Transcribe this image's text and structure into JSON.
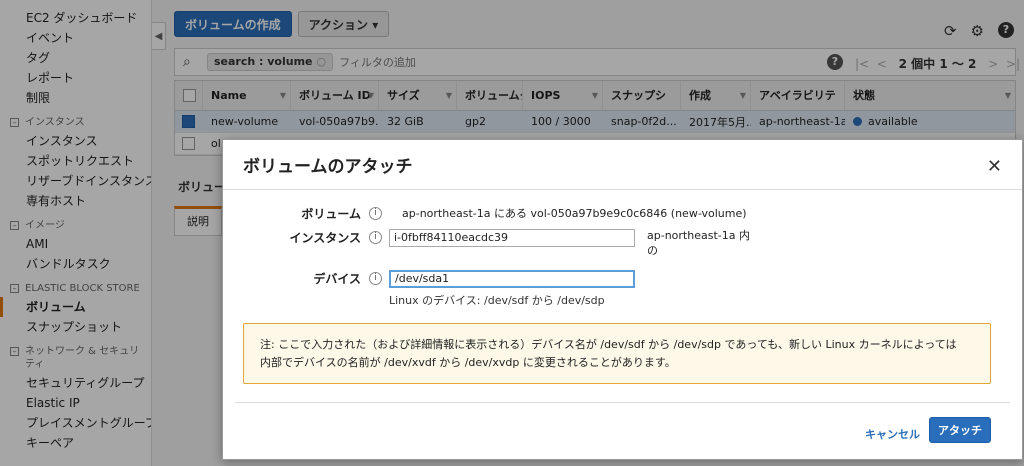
{
  "sidebar": {
    "items": [
      {
        "label": "EC2 ダッシュボード",
        "type": "item"
      },
      {
        "label": "イベント",
        "type": "item"
      },
      {
        "label": "タグ",
        "type": "item"
      },
      {
        "label": "レポート",
        "type": "item"
      },
      {
        "label": "制限",
        "type": "item"
      },
      {
        "label": "インスタンス",
        "type": "section"
      },
      {
        "label": "インスタンス",
        "type": "item"
      },
      {
        "label": "スポットリクエスト",
        "type": "item"
      },
      {
        "label": "リザーブドインスタンス",
        "type": "item"
      },
      {
        "label": "専有ホスト",
        "type": "item"
      },
      {
        "label": "イメージ",
        "type": "section"
      },
      {
        "label": "AMI",
        "type": "item"
      },
      {
        "label": "バンドルタスク",
        "type": "item"
      },
      {
        "label": "ELASTIC BLOCK STORE",
        "type": "section"
      },
      {
        "label": "ボリューム",
        "type": "item",
        "active": true
      },
      {
        "label": "スナップショット",
        "type": "item"
      },
      {
        "label": "ネットワーク & セキュリティ",
        "type": "section"
      },
      {
        "label": "セキュリティグループ",
        "type": "item"
      },
      {
        "label": "Elastic IP",
        "type": "item"
      },
      {
        "label": "プレイスメントグループ",
        "type": "item"
      },
      {
        "label": "キーペア",
        "type": "item"
      }
    ],
    "collapse_glyph": "◀"
  },
  "toolbar": {
    "create_label": "ボリュームの作成",
    "actions_label": "アクション ▾",
    "refresh_glyph": "⟳",
    "gear_glyph": "⚙",
    "help_glyph": "?"
  },
  "search": {
    "icon": "⌕",
    "chip_label": "search : volume",
    "chip_remove": "○",
    "placeholder": "フィルタの追加",
    "help_glyph": "?",
    "pager_first": "|<",
    "pager_prev": "<",
    "pager_text": "2 個中 1 〜 2",
    "pager_next": ">",
    "pager_last": ">|"
  },
  "table": {
    "columns": [
      "Name",
      "ボリューム ID",
      "サイズ",
      "ボリュームタ",
      "IOPS",
      "スナップシ",
      "作成",
      "アベイラビリテ",
      "状態"
    ],
    "rows": [
      {
        "name": "new-volume",
        "id": "vol-050a97b9...",
        "size": "32 GiB",
        "type": "gp2",
        "iops": "100 / 3000",
        "snap": "snap-0f2d...",
        "created": "2017年5月...",
        "az": "ap-northeast-1a",
        "state": "available"
      },
      {
        "name": "ol",
        "id": "",
        "size": "",
        "type": "",
        "iops": "",
        "snap": "",
        "created": "",
        "az": "",
        "state": ""
      }
    ]
  },
  "detail": {
    "label": "ボリュー",
    "tab": "説明"
  },
  "modal": {
    "title": "ボリュームのアタッチ",
    "close": "✕",
    "volume_label": "ボリューム",
    "volume_value": "ap-northeast-1a にある vol-050a97b9e9c0c6846 (new-volume)",
    "instance_label": "インスタンス",
    "instance_value": "i-0fbff84110eacdc39",
    "instance_suffix_1": "ap-northeast-1a 内",
    "instance_suffix_2": "の",
    "device_label": "デバイス",
    "device_value": "/dev/sda1",
    "device_hint": "Linux のデバイス: /dev/sdf から /dev/sdp",
    "info_glyph": "i",
    "note_line1": "注: ここで入力された（および詳細情報に表示される）デバイス名が /dev/sdf から /dev/sdp であっても、新しい Linux カーネルによっては",
    "note_line2": "内部でデバイスの名前が /dev/xvdf から /dev/xvdp に変更されることがあります。",
    "cancel_label": "キャンセル",
    "attach_label": "アタッチ"
  }
}
